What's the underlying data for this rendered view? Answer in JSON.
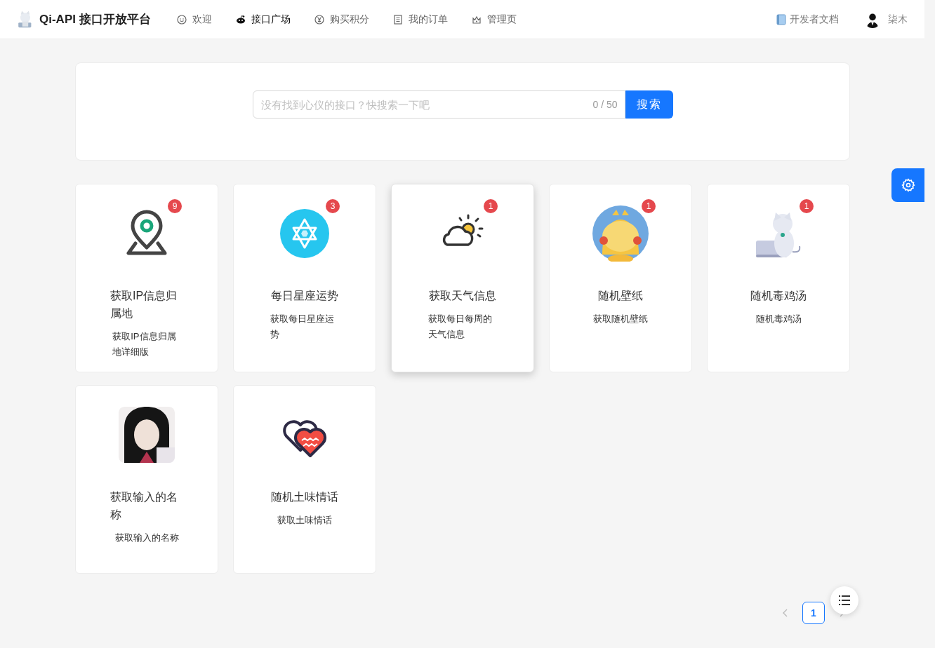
{
  "header": {
    "title": "Qi-API 接口开放平台",
    "menu": [
      {
        "label": "欢迎",
        "selected": false
      },
      {
        "label": "接口广场",
        "selected": true
      },
      {
        "label": "购买积分",
        "selected": false
      },
      {
        "label": "我的订单",
        "selected": false
      },
      {
        "label": "管理页",
        "selected": false
      }
    ],
    "docs_link": "开发者文档",
    "user": {
      "name": "柒木"
    }
  },
  "search": {
    "placeholder": "没有找到心仪的接口？快搜索一下吧",
    "count": "0 / 50",
    "button": "搜索"
  },
  "cards": [
    {
      "kind": "pin",
      "title": "获取IP信息归属地",
      "description": "获取IP信息归属地详细版",
      "badge": "9",
      "hovered": false
    },
    {
      "kind": "star",
      "title": "每日星座运势",
      "description": "获取每日星座运势",
      "badge": "3",
      "hovered": false
    },
    {
      "kind": "weather",
      "title": "获取天气信息",
      "description": "获取每日每周的天气信息",
      "badge": "1",
      "hovered": true
    },
    {
      "kind": "picture",
      "title": "随机壁纸",
      "description": "获取随机壁纸",
      "badge": "1",
      "hovered": false
    },
    {
      "kind": "picture",
      "title": "随机毒鸡汤",
      "description": "随机毒鸡汤",
      "badge": "1",
      "hovered": false
    },
    {
      "kind": "picture",
      "title": "获取输入的名称",
      "description": "获取输入的名称",
      "hovered": false
    },
    {
      "kind": "hearts",
      "title": "随机土味情话",
      "description": "获取土味情话",
      "hovered": false
    }
  ],
  "pagination": {
    "pages": [
      {
        "label": "1",
        "selected": true
      }
    ]
  }
}
